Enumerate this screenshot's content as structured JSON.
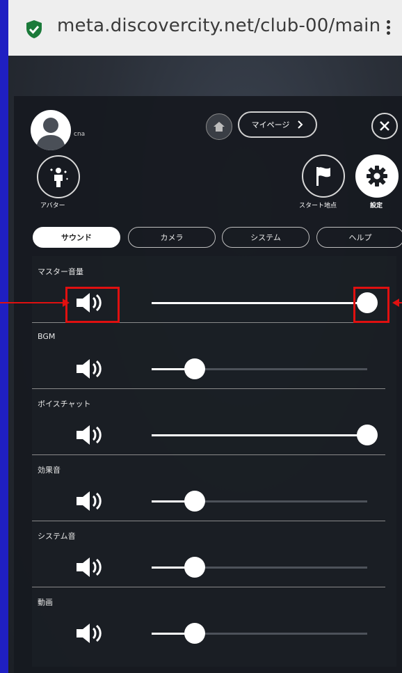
{
  "browser": {
    "url": "meta.discovercity.net/club-00/main"
  },
  "header": {
    "username": "cna",
    "mypage_label": "マイページ",
    "avatar_label": "アバター",
    "start_point_label": "スタート地点",
    "settings_label": "設定"
  },
  "tabs": [
    {
      "label": "サウンド",
      "active": true
    },
    {
      "label": "カメラ",
      "active": false
    },
    {
      "label": "システム",
      "active": false
    },
    {
      "label": "ヘルプ",
      "active": false
    }
  ],
  "sound": {
    "rows": [
      {
        "label": "マスター音量",
        "level": 1.0
      },
      {
        "label": "BGM",
        "level": 0.2
      },
      {
        "label": "ボイスチャット",
        "level": 1.0
      },
      {
        "label": "効果音",
        "level": 0.2
      },
      {
        "label": "システム音",
        "level": 0.2
      },
      {
        "label": "動画",
        "level": 0.2
      }
    ]
  },
  "colors": {
    "highlight": "#e01010",
    "accent": "#ffffff"
  }
}
